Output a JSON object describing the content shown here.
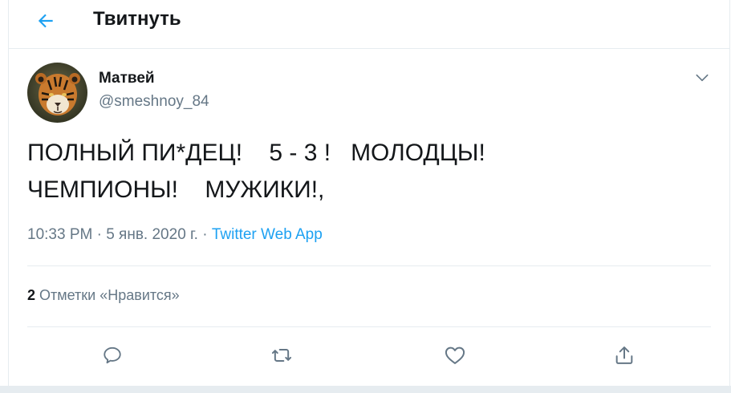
{
  "header": {
    "title": "Твитнуть",
    "back_icon": "arrow-left-icon"
  },
  "tweet": {
    "author_name": "Матвей",
    "author_handle": "@smeshnoy_84",
    "line1": "ПОЛНЫЙ ПИ*ДЕЦ!    5 - 3 !   МОЛОДЦЫ!",
    "line2": "ЧЕМПИОНЫ!    МУЖИКИ!,",
    "time": "10:33 PM · 5 янв. 2020 г. · ",
    "source": "Twitter Web App"
  },
  "stats": {
    "likes_count": "2",
    "likes_label": " Отметки «Нравится»"
  },
  "actions": [
    "reply-icon",
    "retweet-icon",
    "like-icon",
    "share-icon"
  ],
  "colors": {
    "accent": "#1da1f2",
    "secondary_text": "#657786",
    "border": "#e6ecf0"
  }
}
